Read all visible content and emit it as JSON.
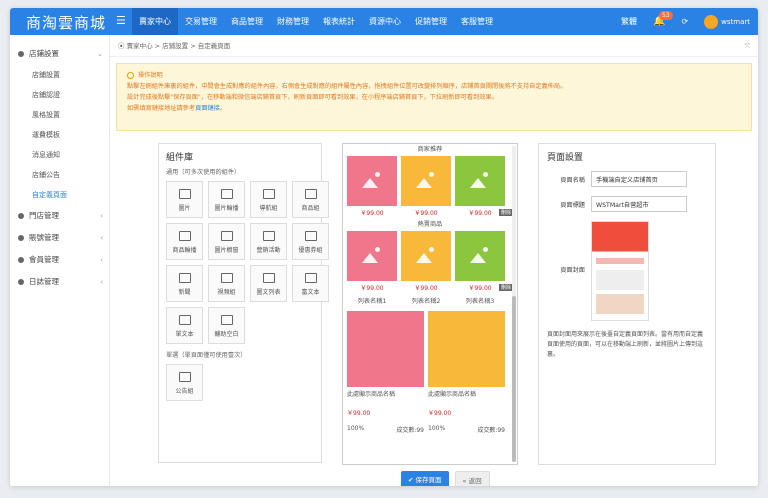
{
  "app": {
    "logo": "商淘雲商城",
    "menu_icon": "☰"
  },
  "nav": [
    "賣家中心",
    "交易管理",
    "商品管理",
    "財務管理",
    "報表統計",
    "資源中心",
    "促銷管理",
    "客服管理"
  ],
  "topright": {
    "lang": "繁體",
    "badge": "53",
    "user": "wstmart"
  },
  "sidebar": {
    "groups": [
      {
        "label": "店鋪設置",
        "expanded": true,
        "subs": [
          "店鋪設置",
          "店鋪認證",
          "風格設置",
          "運費模板",
          "消息通知",
          "店鋪公告",
          "自定義頁面"
        ]
      },
      {
        "label": "門店管理"
      },
      {
        "label": "賬號管理"
      },
      {
        "label": "會員管理"
      },
      {
        "label": "日誌管理"
      }
    ]
  },
  "breadcrumb": "賣家中心 > 店鋪設置 > 自定義頁面",
  "notice": {
    "title": "操作說明",
    "lines": [
      "點擊左側組件庫裏的組件，中間會生成對應的組件內容，右側會生成對應的組件屬性內容，拖拽組件位置可改變排列順序，店鋪首頁關閉後將不支持自定義佈局。",
      "設計完成後點擊\"保存頁面\"，在移動端和微信端店鋪首頁下，刷新頁面即可看到效果，在小程序端店鋪首頁下，下拉刷新即可看到效果。",
      "如需填寫鏈接地址請參考"
    ],
    "link": "頁面鏈接",
    "tail": "。"
  },
  "library": {
    "title": "組件庫",
    "sub1": "通用（可多次使用的組件）",
    "items1": [
      "圖片",
      "圖片輪播",
      "導航組",
      "商品組",
      "商品輪播",
      "圖片櫥窗",
      "營銷活動",
      "優惠券組",
      "新聞",
      "視頻組",
      "圖文列表",
      "富文本",
      "單文本",
      "輔助空白"
    ],
    "sub2": "單選（單頁面僅可使用壹次）",
    "items2": [
      "公告組"
    ]
  },
  "preview": {
    "sec1": "商家推荐",
    "sec2": "熱賣商品",
    "price": "￥99.00",
    "delete": "刪除",
    "labels": [
      "列表名稱1",
      "列表名稱2",
      "列表名稱3"
    ],
    "big_names": [
      "此處顯示商品名稱",
      "此處顯示商品名稱"
    ],
    "big_prices": [
      "￥99.00",
      "￥99.00"
    ],
    "big_pct": [
      "100%",
      "100%"
    ],
    "big_sales": [
      "成交數:99",
      "成交數:99"
    ],
    "colors": [
      "#f0768b",
      "#f8b83a",
      "#8cc63f"
    ]
  },
  "settings": {
    "title": "頁面設置",
    "name_label": "頁面名稱",
    "name_value": "手機端自定义店铺首页",
    "title_label": "頁面標題",
    "title_value": "WSTMart自营超市",
    "cover_label": "頁面封面",
    "desc": "頁面封面用來展示在後臺自定義頁面列表。當有用而自定義頁面使用的頁面，可以在移動端上刷新，並將圖片上傳到這裏。"
  },
  "buttons": {
    "save": "保存頁面",
    "back": "返回"
  }
}
